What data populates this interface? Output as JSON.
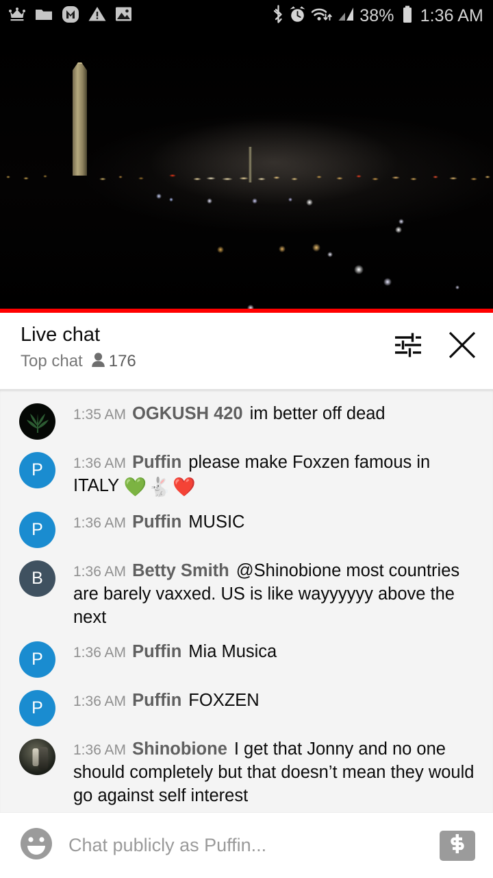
{
  "statusbar": {
    "left_icons": [
      "crown-icon",
      "folder-icon",
      "m-app-icon",
      "warning-triangle-icon",
      "image-icon"
    ],
    "right_icons": [
      "bluetooth-icon",
      "alarm-clock-icon",
      "wifi-icon",
      "cell-signal-icon",
      "battery-icon"
    ],
    "battery_percent": "38%",
    "time": "1:36 AM"
  },
  "video": {
    "description": "night-city-livestream",
    "progress_percent": 100,
    "progress_color": "#ff0000"
  },
  "header": {
    "title": "Live chat",
    "mode": "Top chat",
    "viewer_count": "176",
    "settings_icon": "tune-sliders-icon",
    "close_icon": "close-x-icon"
  },
  "messages": [
    {
      "time": "1:35 AM",
      "author": "OGKUSH 420",
      "text": "im better off dead",
      "avatar_type": "leaf",
      "avatar_letter": "",
      "avatar_color": "#050805"
    },
    {
      "time": "1:36 AM",
      "author": "Puffin",
      "text": "please make Foxzen famous in ITALY ",
      "emojis": "💚🐇❤️",
      "avatar_type": "letter",
      "avatar_letter": "P",
      "avatar_color": "#1a8cd0"
    },
    {
      "time": "1:36 AM",
      "author": "Puffin",
      "text": "MUSIC",
      "avatar_type": "letter",
      "avatar_letter": "P",
      "avatar_color": "#1a8cd0"
    },
    {
      "time": "1:36 AM",
      "author": "Betty Smith",
      "text": "@Shinobione most countries are barely vaxxed. US is like wayyyyyy above the next",
      "avatar_type": "letter",
      "avatar_letter": "B",
      "avatar_color": "#3f5160"
    },
    {
      "time": "1:36 AM",
      "author": "Puffin",
      "text": "Mia Musica",
      "avatar_type": "letter",
      "avatar_letter": "P",
      "avatar_color": "#1a8cd0"
    },
    {
      "time": "1:36 AM",
      "author": "Puffin",
      "text": "FOXZEN",
      "avatar_type": "letter",
      "avatar_letter": "P",
      "avatar_color": "#1a8cd0"
    },
    {
      "time": "1:36 AM",
      "author": "Shinobione",
      "text": "I get that Jonny and no one should completely but that doesn’t mean they would go against self interest",
      "avatar_type": "photo",
      "avatar_letter": "",
      "avatar_color": "#2b2e26"
    }
  ],
  "input": {
    "placeholder": "Chat publicly as Puffin...",
    "value": "",
    "emoji_icon": "emoji-smiley-icon",
    "superchat_icon": "dollar-sign-icon"
  }
}
